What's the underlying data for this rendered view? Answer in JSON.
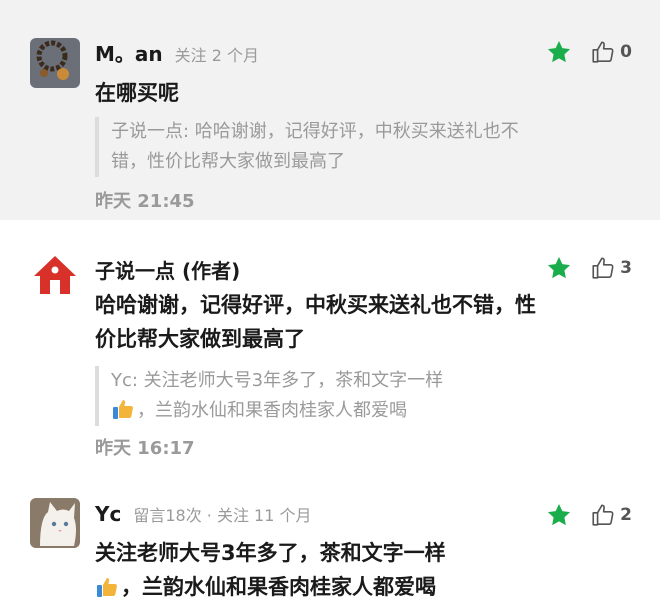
{
  "comments": [
    {
      "name": "M。an",
      "meta": "关注 2 个月",
      "likes": "0",
      "text": "在哪买呢",
      "quote": "子说一点: 哈哈谢谢，记得好评，中秋买来送礼也不错，性价比帮大家做到最高了",
      "time": "昨天 21:45",
      "avatar_icon": "bracelet-avatar"
    },
    {
      "name": "子说一点 (作者)",
      "likes": "3",
      "text": "哈哈谢谢，记得好评，中秋买来送礼也不错，性价比帮大家做到最高了",
      "quote_line1": "Yc: 关注老师大号3年多了，茶和文字一样",
      "quote_line2": "，兰韵水仙和果香肉桂家人都爱喝",
      "time": "昨天 16:17",
      "avatar_icon": "house-logo-avatar"
    },
    {
      "name": "Yc",
      "meta": "留言18次 · 关注 11 个月",
      "likes": "2",
      "text_line1": "关注老师大号3年多了，茶和文字一样",
      "text_line2": "，兰韵水仙和果香肉桂家人都爱喝",
      "avatar_icon": "cat-avatar"
    }
  ],
  "colors": {
    "star": "#1aad4b",
    "gray_text": "#9a9a9a",
    "highlight_bg": "#f2f2f2",
    "author_red": "#d8312a"
  }
}
